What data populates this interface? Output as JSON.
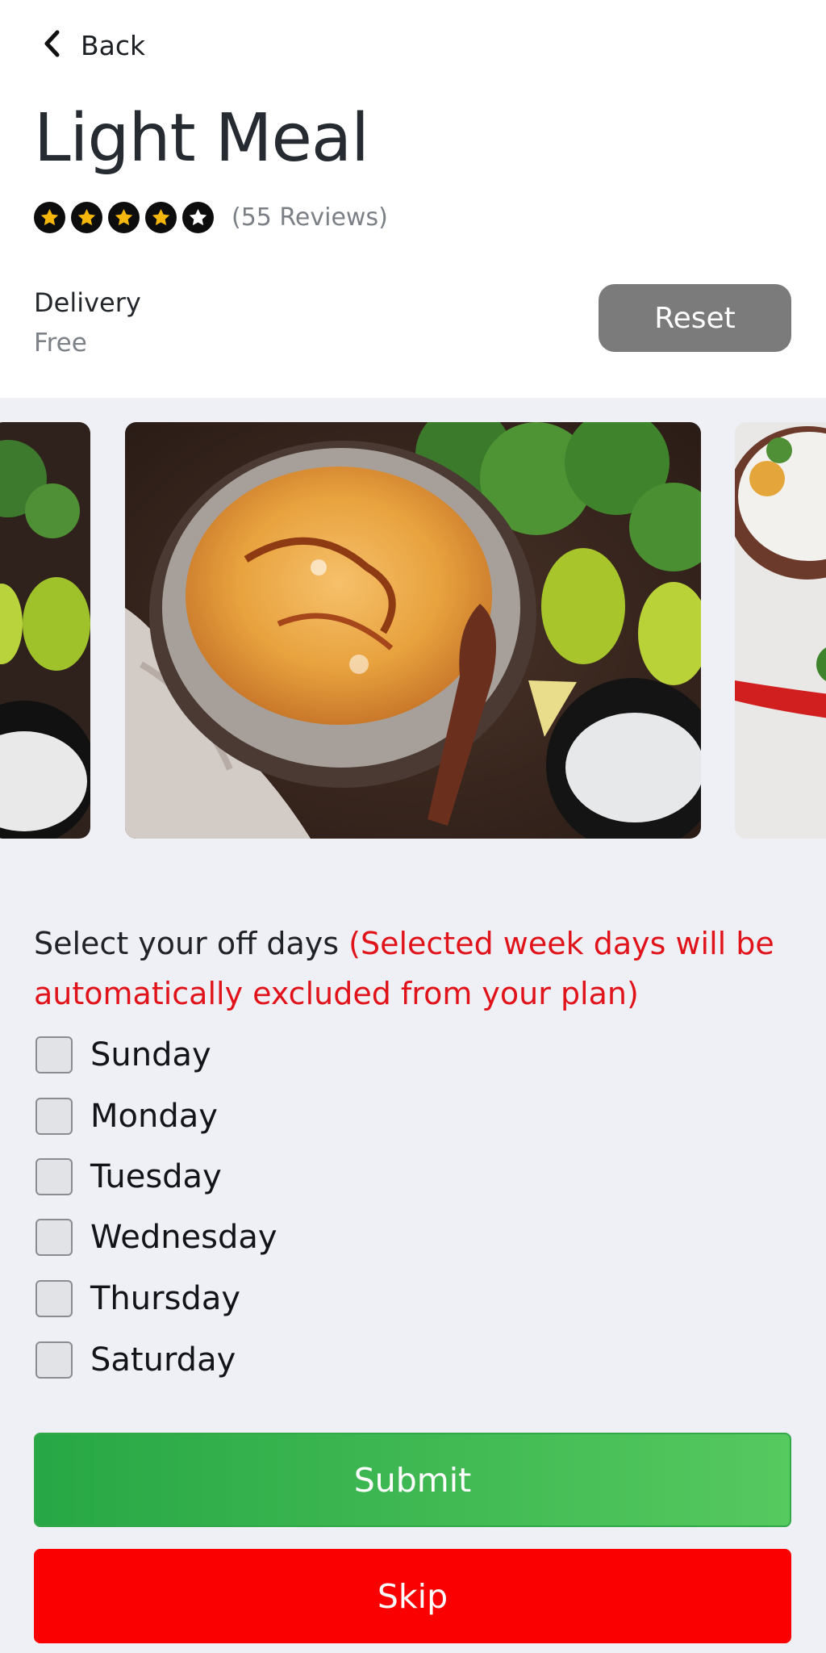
{
  "nav": {
    "back_label": "Back"
  },
  "meal": {
    "title": "Light Meal",
    "rating": {
      "filled_stars": 4,
      "total_stars": 5
    },
    "reviews_text": "(55 Reviews)",
    "delivery_label": "Delivery",
    "delivery_value": "Free"
  },
  "actions": {
    "reset_label": "Reset",
    "submit_label": "Submit",
    "skip_label": "Skip"
  },
  "offdays": {
    "heading": "Select your off days",
    "note": "(Selected week days will be automatically excluded from your plan)",
    "days": [
      {
        "label": "Sunday",
        "checked": false
      },
      {
        "label": "Monday",
        "checked": false
      },
      {
        "label": "Tuesday",
        "checked": false
      },
      {
        "label": "Wednesday",
        "checked": false
      },
      {
        "label": "Thursday",
        "checked": false
      },
      {
        "label": "Saturday",
        "checked": false
      }
    ]
  },
  "colors": {
    "star_fill": "#f5b70a",
    "note_red": "#e1131a",
    "submit_green": "#3bb653",
    "skip_red": "#fb0000",
    "reset_gray": "#7b7b7b"
  }
}
